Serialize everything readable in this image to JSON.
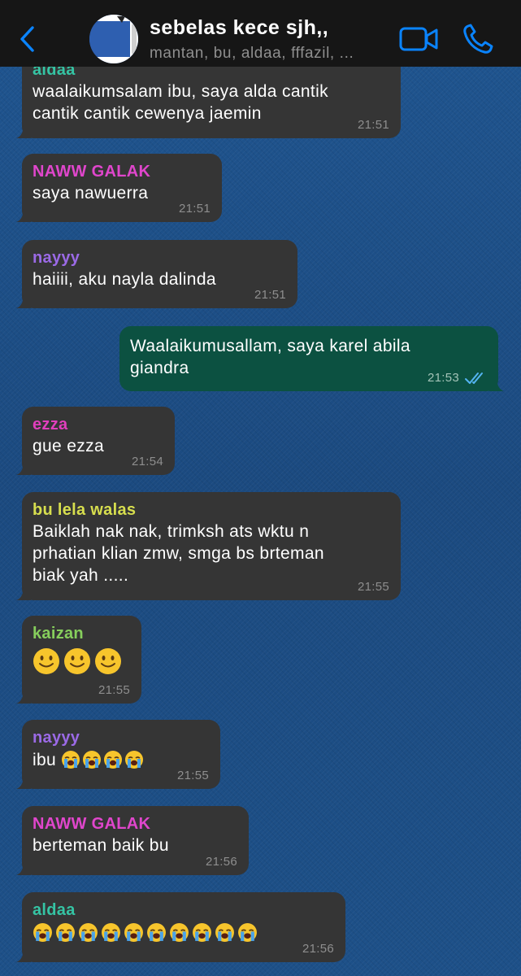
{
  "header": {
    "title": "sebelas kece sjh,,",
    "subtitle": "mantan, bu, aldaa, fffazil, ..."
  },
  "colors": {
    "accent": "#0a84ff",
    "header_bg": "#161616",
    "incoming_bubble": "#353535",
    "outgoing_bubble": "#0c5141",
    "sender_aldaa": "#35c4a4",
    "sender_naww_galak": "#e046cc",
    "sender_nayyy": "#9b6ae6",
    "sender_ezza": "#e13fbd",
    "sender_bu_lela_walas": "#d7de4e",
    "sender_kaizan": "#86ce5c"
  },
  "messages": [
    {
      "sender": "aldaa",
      "text": "waalaikumsalam ibu, saya alda cantik cantik cantik cewenya jaemin",
      "time": "21:51"
    },
    {
      "sender": "NAWW GALAK",
      "text": "saya nawuerra",
      "time": "21:51"
    },
    {
      "sender": "nayyy",
      "text": "haiiii, aku nayla dalinda",
      "time": "21:51"
    },
    {
      "sender": "",
      "text": "Waalaikumusallam, saya karel abila giandra",
      "time": "21:53",
      "status": "read"
    },
    {
      "sender": "ezza",
      "text": "gue ezza",
      "time": "21:54"
    },
    {
      "sender": "bu lela walas",
      "text": "Baiklah nak nak, trimksh ats wktu n prhatian klian zmw, smga bs brteman biak yah .....",
      "time": "21:55"
    },
    {
      "sender": "kaizan",
      "text": "",
      "emoji": [
        "slightly-smiling-face",
        "slightly-smiling-face",
        "slightly-smiling-face"
      ],
      "time": "21:55"
    },
    {
      "sender": "nayyy",
      "text": "ibu",
      "emoji": [
        "loudly-crying-face",
        "loudly-crying-face",
        "loudly-crying-face",
        "loudly-crying-face"
      ],
      "time": "21:55"
    },
    {
      "sender": "NAWW GALAK",
      "text": "berteman baik bu",
      "time": "21:56"
    },
    {
      "sender": "aldaa",
      "text": "",
      "emoji": [
        "loudly-crying-face",
        "loudly-crying-face",
        "loudly-crying-face",
        "loudly-crying-face",
        "loudly-crying-face",
        "loudly-crying-face",
        "loudly-crying-face",
        "loudly-crying-face",
        "loudly-crying-face",
        "loudly-crying-face"
      ],
      "time": "21:56"
    }
  ]
}
